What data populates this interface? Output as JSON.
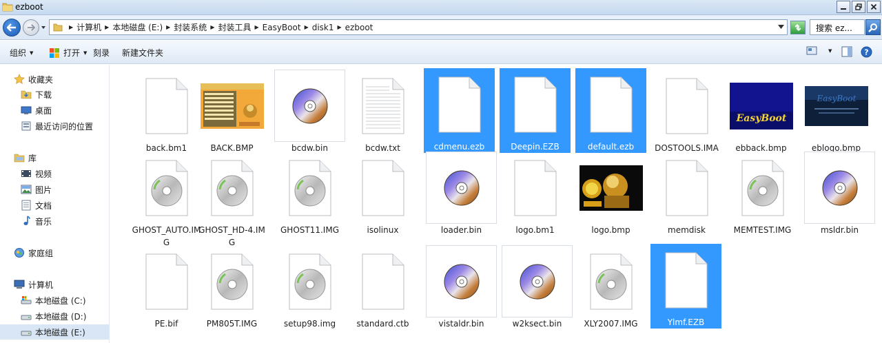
{
  "window": {
    "title": "ezboot"
  },
  "address": {
    "crumbs": [
      "计算机",
      "本地磁盘 (E:)",
      "封装系统",
      "封装工具",
      "EasyBoot",
      "disk1",
      "ezboot"
    ],
    "search_placeholder": "搜索 ez..."
  },
  "toolbar": {
    "organize": "组织",
    "open": "打开",
    "burn": "刻录",
    "new_folder": "新建文件夹"
  },
  "sidebar": {
    "favorites": "收藏夹",
    "downloads": "下载",
    "desktop": "桌面",
    "recent": "最近访问的位置",
    "libraries": "库",
    "videos": "视频",
    "pictures": "图片",
    "documents": "文档",
    "music": "音乐",
    "homegroup": "家庭组",
    "computer": "计算机",
    "drive_c": "本地磁盘 (C:)",
    "drive_d": "本地磁盘 (D:)",
    "drive_e": "本地磁盘 (E:)"
  },
  "files": [
    {
      "name": "back.bm1",
      "icon": "blank-file-icon",
      "selected": false
    },
    {
      "name": "BACK.BMP",
      "icon": "menu-screenshot-thumbnail",
      "selected": false
    },
    {
      "name": "bcdw.bin",
      "icon": "disc-image-icon",
      "selected": false
    },
    {
      "name": "bcdw.txt",
      "icon": "text-file-icon",
      "selected": false
    },
    {
      "name": "cdmenu.ezb",
      "icon": "blank-file-icon",
      "selected": true
    },
    {
      "name": "Deepin.EZB",
      "icon": "blank-file-icon",
      "selected": true
    },
    {
      "name": "default.ezb",
      "icon": "blank-file-icon",
      "selected": true
    },
    {
      "name": "DOSTOOLS.IMA",
      "icon": "blank-file-icon",
      "selected": false
    },
    {
      "name": "ebback.bmp",
      "icon": "easyboot-logo-thumbnail",
      "selected": false
    },
    {
      "name": "eblogo.bmp",
      "icon": "easyboot-dark-thumbnail",
      "selected": false
    },
    {
      "name": "GHOST_AUTO.IMG",
      "icon": "cd-file-icon",
      "selected": false
    },
    {
      "name": "GHOST_HD-4.IMG",
      "icon": "cd-file-icon",
      "selected": false
    },
    {
      "name": "GHOST11.IMG",
      "icon": "cd-file-icon",
      "selected": false
    },
    {
      "name": "isolinux",
      "icon": "blank-file-icon",
      "selected": false
    },
    {
      "name": "loader.bin",
      "icon": "disc-image-icon",
      "selected": false
    },
    {
      "name": "logo.bm1",
      "icon": "blank-file-icon",
      "selected": false
    },
    {
      "name": "logo.bmp",
      "icon": "ghost-logo-thumbnail",
      "selected": false
    },
    {
      "name": "memdisk",
      "icon": "blank-file-icon",
      "selected": false
    },
    {
      "name": "MEMTEST.IMG",
      "icon": "cd-file-icon",
      "selected": false
    },
    {
      "name": "msldr.bin",
      "icon": "disc-image-icon",
      "selected": false
    },
    {
      "name": "PE.bif",
      "icon": "blank-file-icon",
      "selected": false
    },
    {
      "name": "PM805T.IMG",
      "icon": "cd-file-icon",
      "selected": false
    },
    {
      "name": "setup98.img",
      "icon": "cd-file-icon",
      "selected": false
    },
    {
      "name": "standard.ctb",
      "icon": "blank-file-icon",
      "selected": false
    },
    {
      "name": "vistaldr.bin",
      "icon": "disc-image-icon",
      "selected": false
    },
    {
      "name": "w2ksect.bin",
      "icon": "disc-image-icon",
      "selected": false
    },
    {
      "name": "XLY2007.IMG",
      "icon": "cd-file-icon",
      "selected": false
    },
    {
      "name": "Ylmf.EZB",
      "icon": "blank-file-icon",
      "selected": true
    }
  ],
  "thumbnail_text": {
    "easyboot_logo": "EasyBoot",
    "easyboot_dark": "EasyBoot"
  },
  "colors": {
    "selection": "#3399ff",
    "nav_selected": "#d9e6f5"
  }
}
